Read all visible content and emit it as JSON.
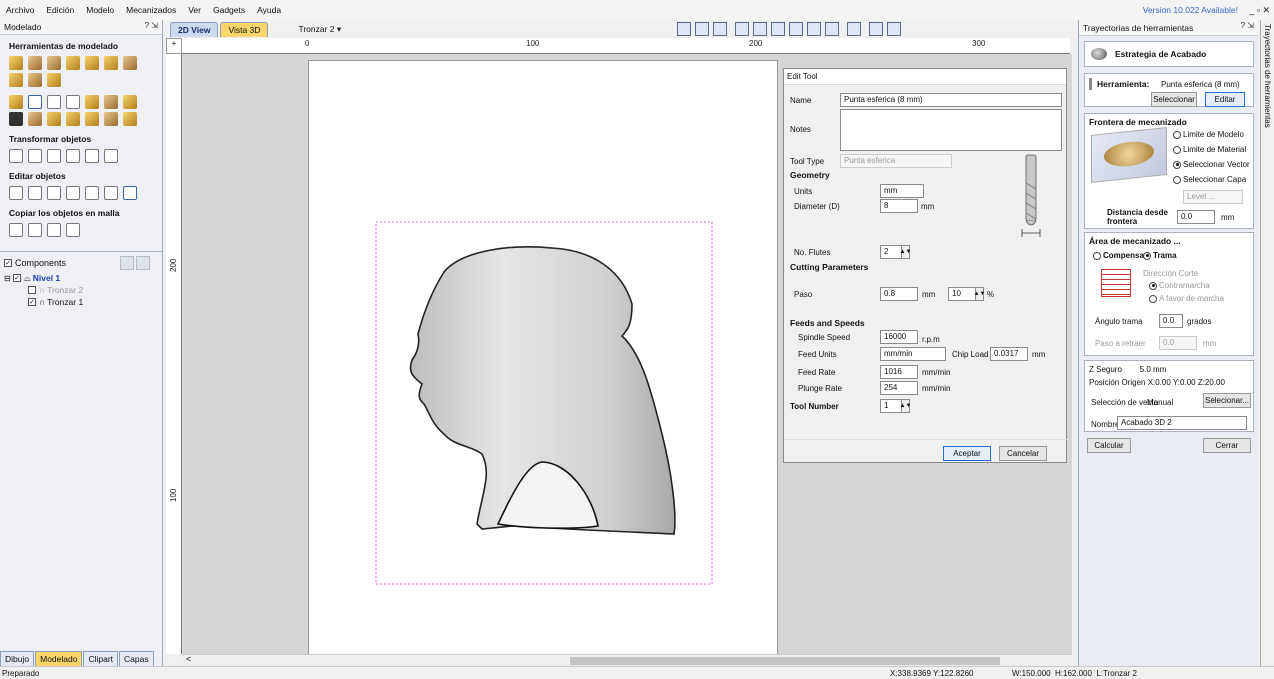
{
  "menu": {
    "items": [
      "Archivo",
      "Edición",
      "Modelo",
      "Mecanizados",
      "Ver",
      "Gadgets",
      "Ayuda"
    ],
    "version": "Version 10.022 Available!",
    "window_controls": "_ ▫ ✕"
  },
  "left_panel": {
    "title": "Modelado",
    "header_buttons": "? ⇲",
    "sections": {
      "modeling_tools": "Herramientas de modelado",
      "transform": "Transformar objetos",
      "edit": "Editar objetos",
      "copy": "Copiar los objetos en malla"
    },
    "components_label": "Components",
    "tree": {
      "level": "Nivel 1",
      "item1": "Tronzar 2",
      "item2": "Tronzar 1"
    },
    "tabs": [
      "Dibujo",
      "Modelado",
      "Clipart",
      "Capas"
    ]
  },
  "view": {
    "tab_2d": "2D View",
    "tab_3d": "Vista 3D",
    "component_selector": "Tronzar 2 ▾",
    "ruler_h": [
      "0",
      "100",
      "200",
      "300"
    ],
    "ruler_v": [
      "200",
      "100"
    ],
    "scroll_left": "<"
  },
  "dialog": {
    "title": "Edit Tool",
    "name_label": "Name",
    "name_value": "Punta esferica (8 mm)",
    "notes_label": "Notes",
    "tool_type_label": "Tool Type",
    "tool_type_value": "Punta esferica",
    "geometry": "Geometry",
    "units_label": "Units",
    "units_value": "mm",
    "diameter_label": "Diameter (D)",
    "diameter_value": "8",
    "diameter_unit": "mm",
    "flutes_label": "No. Flutes",
    "flutes_value": "2",
    "cutting": "Cutting Parameters",
    "paso_label": "Paso",
    "paso_value": "0.8",
    "paso_unit": "mm",
    "paso_pct": "10",
    "pct_sign": "%",
    "feeds": "Feeds and Speeds",
    "spindle_label": "Spindle Speed",
    "spindle_value": "16000",
    "spindle_unit": "r.p.m",
    "feed_units_label": "Feed Units",
    "feed_units_value": "mm/min",
    "chip_load_label": "Chip Load",
    "chip_load_value": "0.0317",
    "chip_load_unit": "mm",
    "feed_rate_label": "Feed Rate",
    "feed_rate_value": "1016",
    "feed_rate_unit": "mm/min",
    "plunge_label": "Plunge Rate",
    "plunge_value": "254",
    "plunge_unit": "mm/min",
    "tool_number_label": "Tool Number",
    "tool_number_value": "1",
    "ok": "Aceptar",
    "cancel": "Cancelar"
  },
  "right_panel": {
    "title": "Trayectorias de herramientas",
    "side_tab": "Trayectorias de herramientas",
    "strategy": "Estrategia de Acabado",
    "tool_label": "Herramienta:",
    "tool_value": "Punta esferica (8 mm)",
    "select": "Seleccionar",
    "edit": "Editar",
    "frontier_title": "Frontera de mecanizado",
    "frontier_options": [
      "Limite de Modelo",
      "Limite de Material",
      "Seleccionar Vector",
      "Seleccionar Capa"
    ],
    "level_placeholder": "Level ...",
    "distance_label": "Distancia desde frontera",
    "distance_value": "0.0",
    "distance_unit": "mm",
    "area_title": "Área de mecanizado ...",
    "area_opt1": "Compensa",
    "area_opt2": "Trama",
    "cut_dir": "Dirección Corte",
    "climb": "Contramarcha",
    "conventional": "A favor de marcha",
    "angle_label": "Ángulo trama",
    "angle_value": "0.0",
    "angle_unit": "grados",
    "retract_label": "Paso a retraer",
    "retract_value": "0.0",
    "retract_unit": "mm",
    "safe_z": "Z Seguro        5.0 mm",
    "origin": "Posición Origen X:0.00 Y:0.00 Z:20.00",
    "vector_sel_label": "Selección de vecto",
    "vector_sel_value": "Manual",
    "vector_sel_btn": "Selecionar...",
    "name_label": "Nombre:",
    "name_value": "Acabado 3D 2",
    "calc": "Calcular",
    "close": "Cerrar"
  },
  "status": {
    "left": "Preparado",
    "coords": "X:338.9369 Y:122.8260",
    "dims": "W:150.000  H:162.000  L:Tronzar 2"
  }
}
